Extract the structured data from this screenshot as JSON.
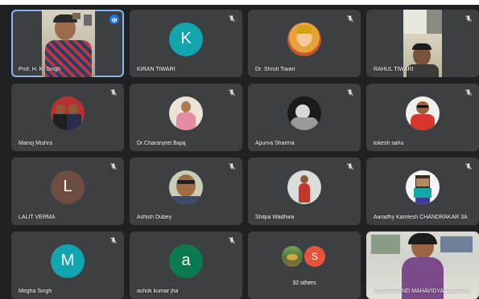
{
  "participants": [
    {
      "name": "Prof. H. K. Singh",
      "type": "video"
    },
    {
      "name": "KIRAN TIWARI",
      "initial": "K",
      "color": "#12a4af"
    },
    {
      "name": "Dr. Shruti Tiwari",
      "type": "photo"
    },
    {
      "name": "RAHUL TIWARI",
      "type": "video"
    },
    {
      "name": "Manoj Mishra",
      "type": "photo"
    },
    {
      "name": "Dr.Charanjeet Bajaj",
      "type": "photo"
    },
    {
      "name": "Apurva Sharma",
      "type": "photo"
    },
    {
      "name": "lokesh sahu",
      "type": "photo"
    },
    {
      "name": "LALIT VERMA",
      "initial": "L",
      "color": "#6d4c41"
    },
    {
      "name": "Ashish Dubey",
      "type": "photo"
    },
    {
      "name": "Shilpa Wadhwa",
      "type": "photo"
    },
    {
      "name": "Aaradhy Kamlesh CHANDRAKAR 3A",
      "type": "photo"
    },
    {
      "name": "Megha Singh",
      "initial": "M",
      "color": "#12a4af"
    },
    {
      "name": "ashok kumar jha",
      "initial": "a",
      "color": "#0b7a4f"
    },
    {
      "others_label": "32 others",
      "initial": "S",
      "initial_color": "#e8533c"
    },
    {
      "name": "VIVEKANAND MAHAVIDYALAYA RAI...",
      "type": "video"
    }
  ]
}
